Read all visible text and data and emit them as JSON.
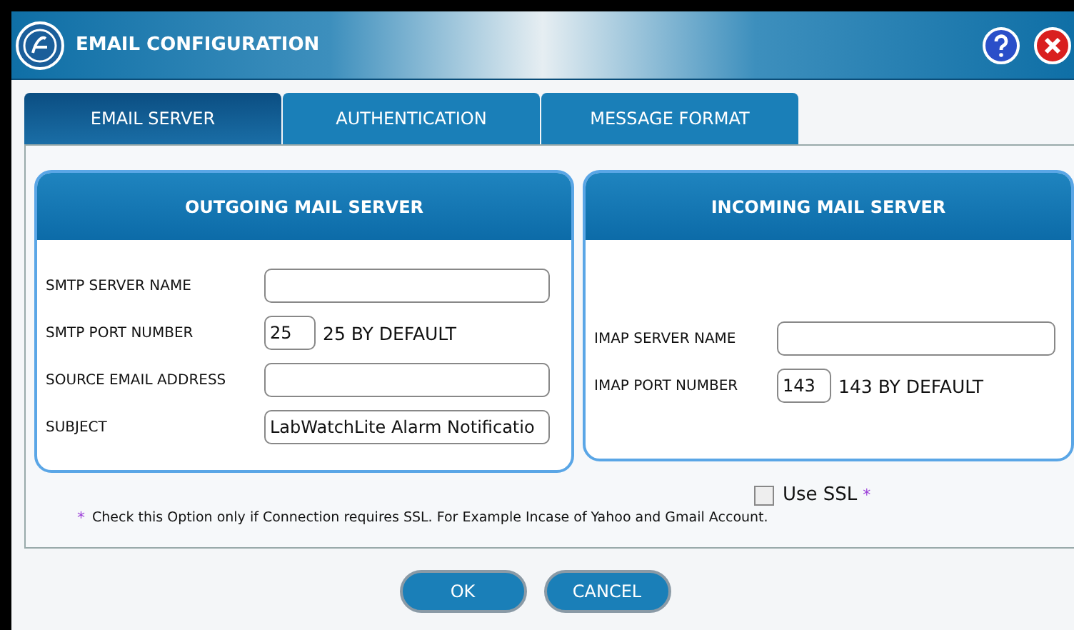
{
  "window": {
    "title": "EMAIL CONFIGURATION"
  },
  "tabs": [
    {
      "label": "EMAIL SERVER",
      "selected": true
    },
    {
      "label": "AUTHENTICATION",
      "selected": false
    },
    {
      "label": "MESSAGE FORMAT",
      "selected": false
    }
  ],
  "panels": [
    {
      "title": "OUTGOING MAIL SERVER",
      "fields": [
        {
          "kind": "text",
          "label": "SMTP SERVER NAME"
        },
        {
          "kind": "port",
          "label": "SMTP PORT NUMBER",
          "value": "25",
          "hint": "25 BY DEFAULT"
        },
        {
          "kind": "text",
          "label": "SOURCE EMAIL ADDRESS"
        },
        {
          "kind": "text",
          "label": "SUBJECT",
          "value": "LabWatchLite Alarm Notificatio"
        }
      ]
    },
    {
      "title": "INCOMING MAIL SERVER",
      "fields": [
        {
          "kind": "text",
          "label": "IMAP SERVER NAME"
        },
        {
          "kind": "port",
          "label": "IMAP PORT NUMBER",
          "value": "143",
          "hint": "143 BY DEFAULT"
        }
      ]
    }
  ],
  "ssl": {
    "label": "Use SSL",
    "mark": "*",
    "checked": false
  },
  "note": {
    "mark": "*",
    "text": "Check this Option only if Connection requires SSL. For Example Incase of Yahoo and Gmail Account."
  },
  "buttons": [
    "OK",
    "CANCEL"
  ]
}
